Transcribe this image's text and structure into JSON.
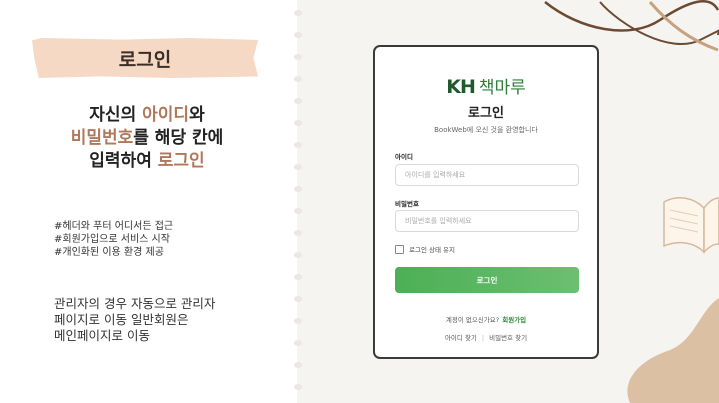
{
  "slide": {
    "title": "로그인",
    "headline": {
      "line1_pre": "자신의 ",
      "line1_hl": "아이디",
      "line1_post": "와",
      "line2_hl": "비밀번호",
      "line2_post": "를 해당 칸에",
      "line3_pre": "입력하여 ",
      "line3_hl": "로그인"
    },
    "tags": [
      "#헤더와 푸터 어디서든 접근",
      "#회원가입으로 서비스 시작",
      "#개인화된 이용 환경 제공"
    ],
    "note_lines": [
      "관리자의 경우 자동으로 관리자",
      "페이지로 이동 일반회원은",
      "메인페이지로 이동"
    ]
  },
  "login_screen": {
    "brand_mark": "KH",
    "brand_name": "책마루",
    "title": "로그인",
    "welcome": "BookWeb에 오신 것을 환영합니다",
    "id_label": "아이디",
    "id_placeholder": "아이디를 입력하세요",
    "pw_label": "비밀번호",
    "pw_placeholder": "비밀번호를 입력하세요",
    "remember_label": "로그인 상태 유지",
    "login_button": "로그인",
    "signup_prompt": "계정이 없으신가요?",
    "signup_link": "회원가입",
    "find_id": "아이디 찾기",
    "find_separator": "|",
    "find_pw": "비밀번호 찾기"
  },
  "colors": {
    "accent": "#b0785a",
    "banner": "#f5d9c5",
    "brand_green": "#2e7d3a",
    "button_green": "#4caf55"
  }
}
